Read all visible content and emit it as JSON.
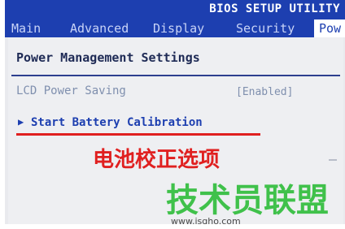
{
  "window": {
    "title": "BIOS SETUP UTILITY"
  },
  "tabs": [
    {
      "label": "Main"
    },
    {
      "label": "Advanced"
    },
    {
      "label": "Display"
    },
    {
      "label": "Security"
    },
    {
      "label": "Pow",
      "active": true
    }
  ],
  "section": {
    "title": "Power Management Settings"
  },
  "settings": [
    {
      "label": "LCD Power Saving",
      "value": "[Enabled]"
    }
  ],
  "submenu": {
    "arrow": "▶",
    "label": "Start Battery Calibration"
  },
  "annotation": {
    "text": "电池校正选项",
    "color": "#e02020"
  },
  "watermark": {
    "brand": "技术员联盟",
    "url": "www.jsgho.com"
  },
  "colors": {
    "bios_blue": "#1d3fb0",
    "background": "#eeeff2",
    "disabled_text": "#7f8fae"
  }
}
